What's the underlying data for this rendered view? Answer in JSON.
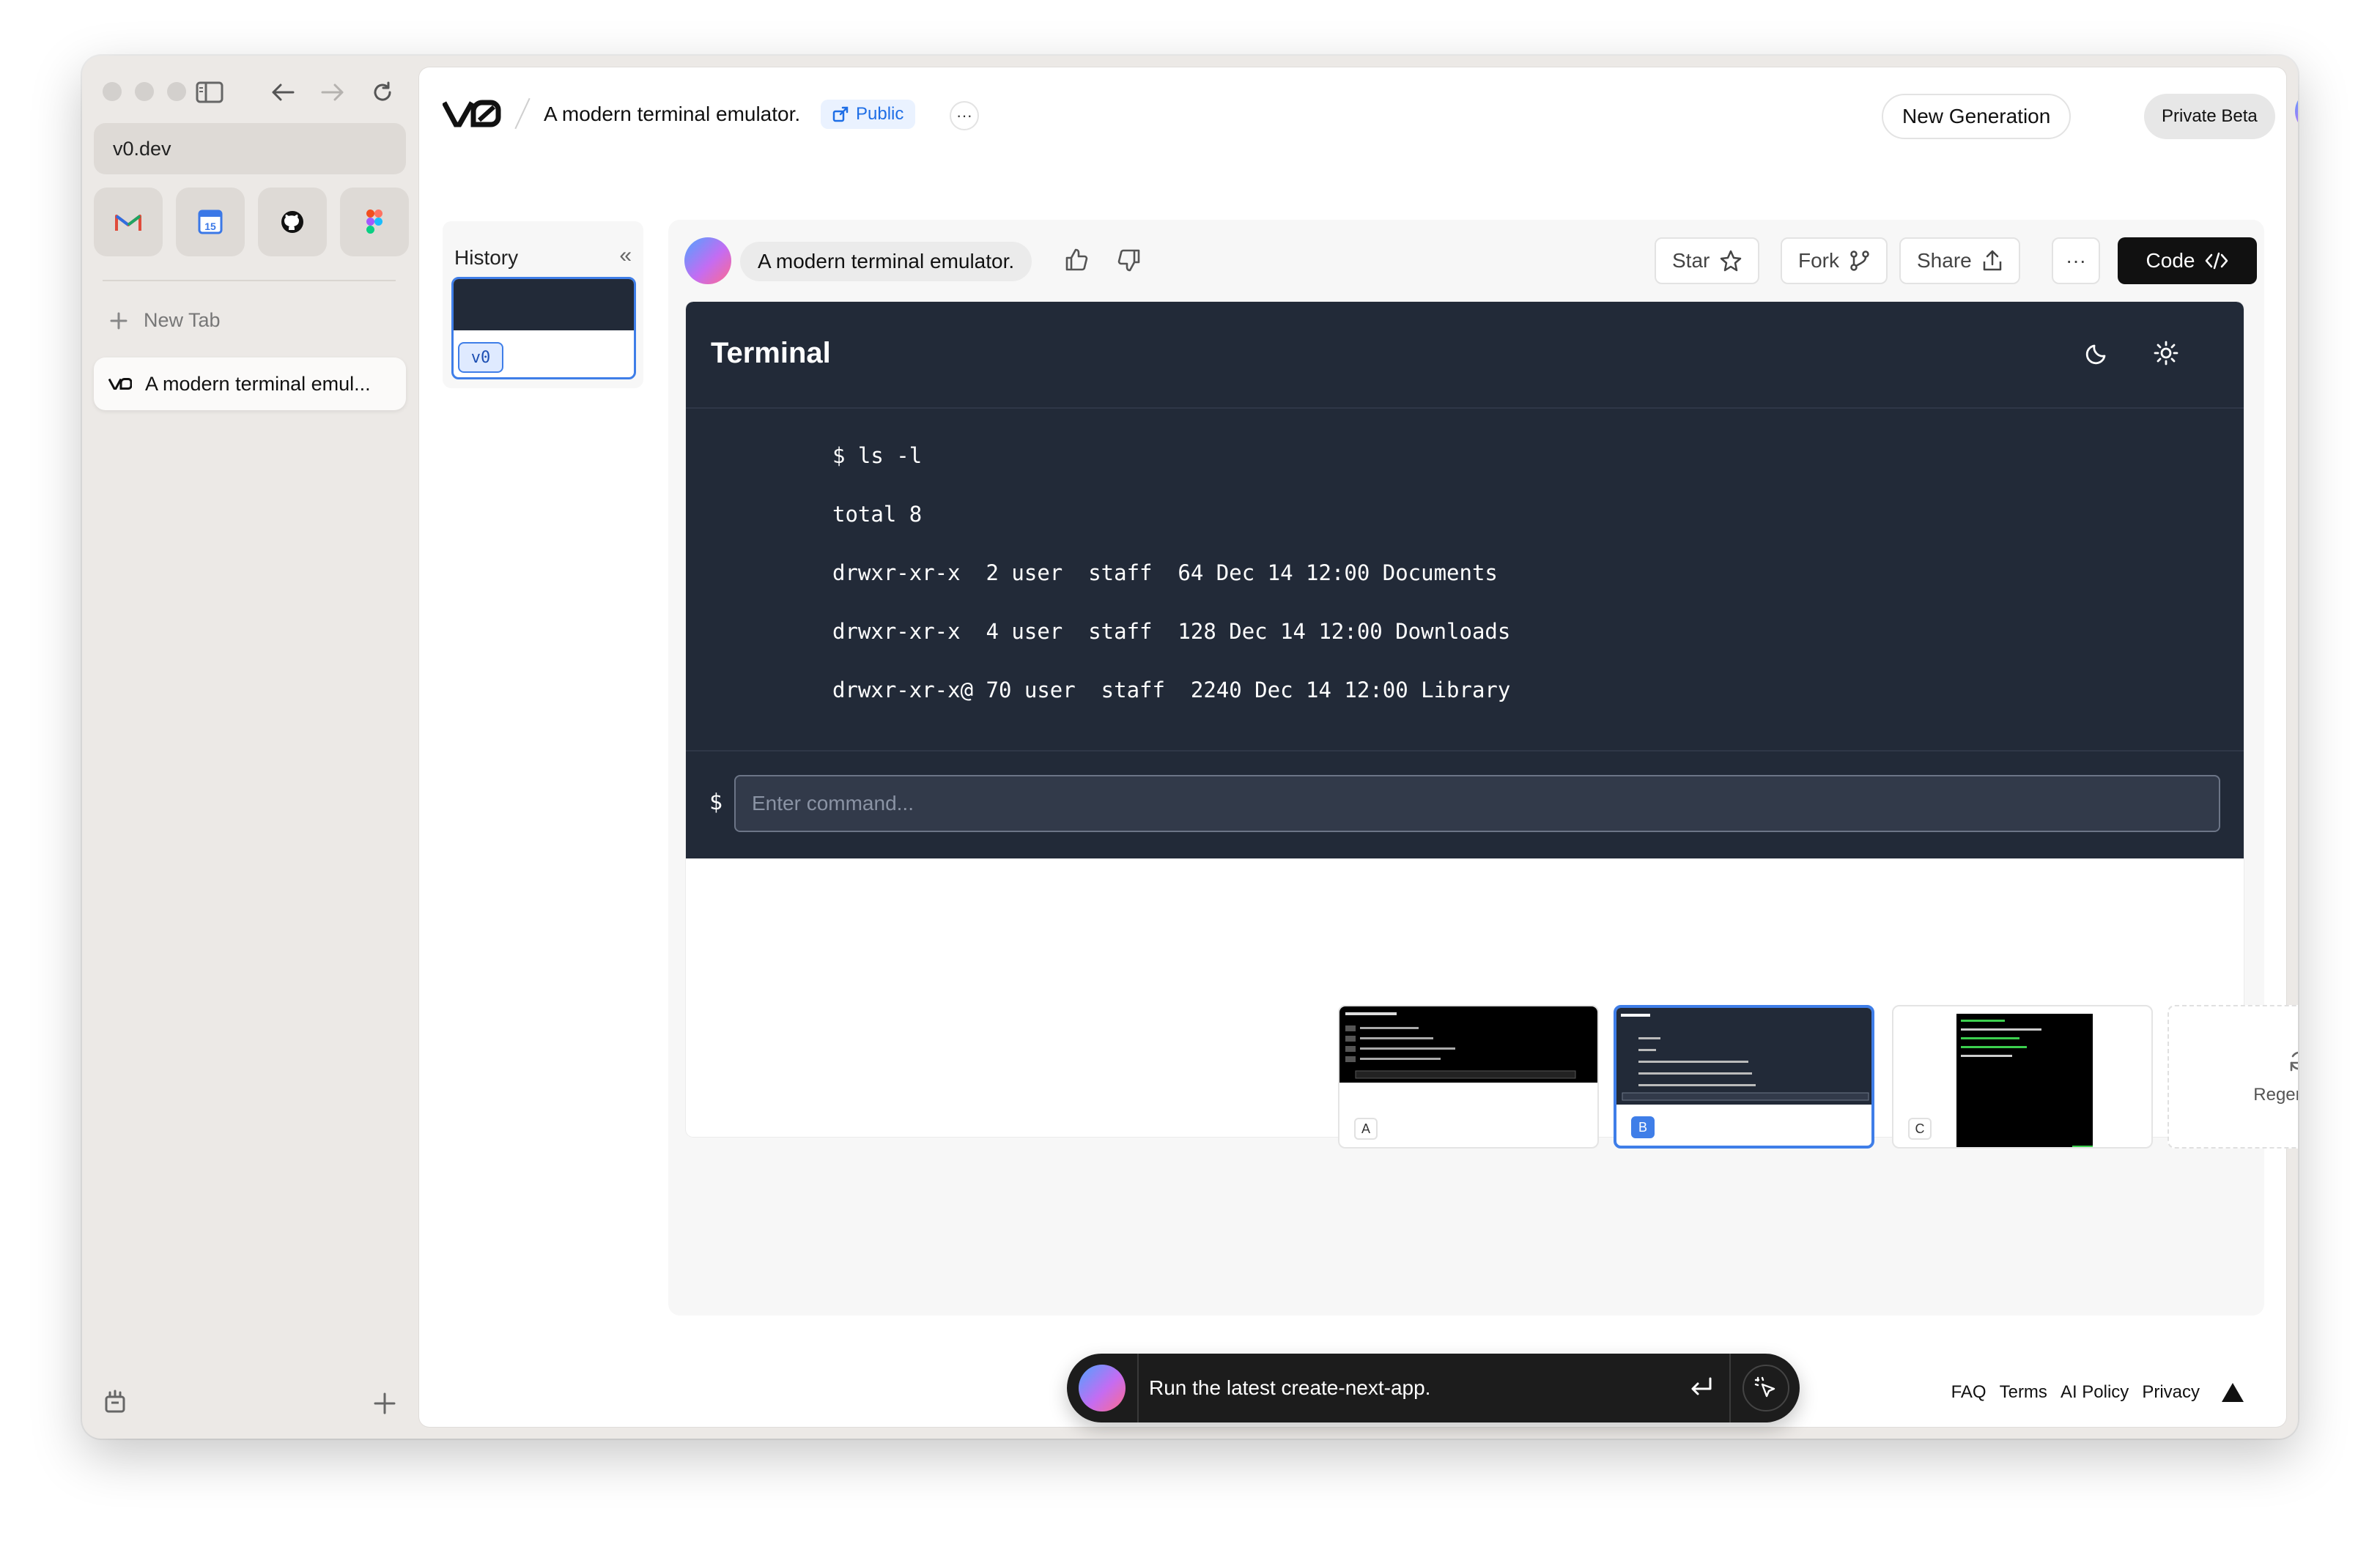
{
  "browser": {
    "url": "v0.dev",
    "favorites": [
      {
        "icon": "gmail-icon"
      },
      {
        "icon": "calendar-icon",
        "date": "15"
      },
      {
        "icon": "github-icon"
      },
      {
        "icon": "figma-icon"
      }
    ],
    "new_tab_label": "New Tab",
    "open_tab_label": "A modern terminal emul..."
  },
  "header": {
    "page_title": "A modern terminal emulator.",
    "visibility": "Public",
    "more": "···",
    "new_generation": "New Generation",
    "private_beta": "Private Beta"
  },
  "history": {
    "label": "History",
    "collapse": "«",
    "version": "v0"
  },
  "prompt": {
    "text": "A modern terminal emulator."
  },
  "actions": {
    "star": "Star",
    "fork": "Fork",
    "share": "Share",
    "more": "···",
    "code": "Code"
  },
  "terminal": {
    "title": "Terminal",
    "lines": [
      "$ ls -l",
      "total 8",
      "drwxr-xr-x  2 user  staff  64 Dec 14 12:00 Documents",
      "drwxr-xr-x  4 user  staff  128 Dec 14 12:00 Downloads",
      "drwxr-xr-x@ 70 user  staff  2240 Dec 14 12:00 Library"
    ],
    "prompt_symbol": "$",
    "input_placeholder": "Enter command..."
  },
  "variants": [
    {
      "label": "A",
      "selected": false
    },
    {
      "label": "B",
      "selected": true
    },
    {
      "label": "C",
      "selected": false
    }
  ],
  "regenerate_label": "Regenerate",
  "chat": {
    "input_value": "Run the latest create-next-app."
  },
  "footer": {
    "links": [
      "FAQ",
      "Terms",
      "AI Policy",
      "Privacy"
    ]
  },
  "colors": {
    "accent": "#3f7ee8",
    "terminal_bg": "#222a38",
    "public_badge": "#1e6ee6"
  }
}
